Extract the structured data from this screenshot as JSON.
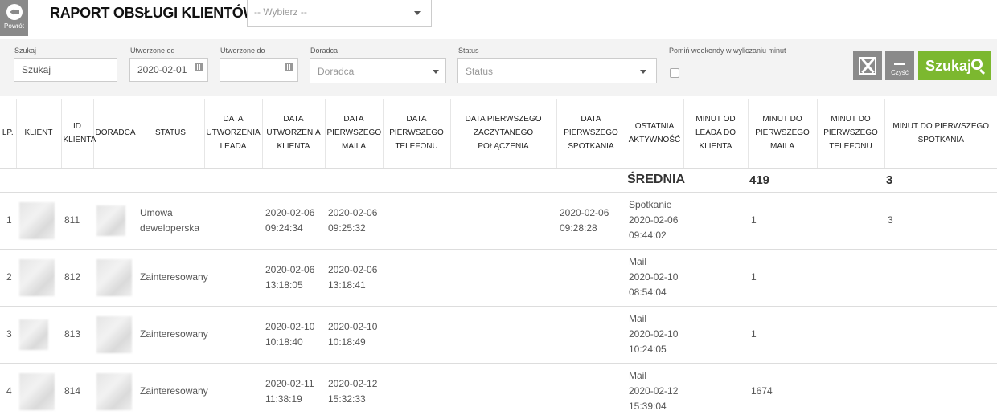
{
  "header": {
    "back_label": "Powrót",
    "title": "RAPORT OBSŁUGI KLIENTÓW",
    "report_select_placeholder": "-- Wybierz --"
  },
  "filters": {
    "search": {
      "label": "Szukaj",
      "value": "Szukaj"
    },
    "created_from": {
      "label": "Utworzone od",
      "value": "2020-02-01"
    },
    "created_to": {
      "label": "Utworzone do",
      "value": ""
    },
    "advisor": {
      "label": "Doradca",
      "placeholder": "Doradca"
    },
    "status": {
      "label": "Status",
      "placeholder": "Status"
    },
    "skip_weekends": {
      "label": "Pomiń weekendy w wyliczaniu minut",
      "checked": false
    },
    "clear_label": "Czyść",
    "search_button_label": "Szukaj"
  },
  "table": {
    "columns": [
      "LP.",
      "KLIENT",
      "ID KLIENTA",
      "DORADCA",
      "STATUS",
      "DATA UTWORZENIA LEADA",
      "DATA UTWORZENIA KLIENTA",
      "DATA PIERWSZEGO MAILA",
      "DATA PIERWSZEGO TELEFONU",
      "DATA PIERWSZEGO ZACZYTANEGO POŁĄCZENIA",
      "DATA PIERWSZEGO SPOTKANIA",
      "OSTATNIA AKTYWNOŚĆ",
      "MINUT OD LEADA DO KLIENTA",
      "MINUT DO PIERWSZEGO MAILA",
      "MINUT DO PIERWSZEGO TELEFONU",
      "MINUT DO PIERWSZEGO SPOTKANIA"
    ],
    "average": {
      "label": "ŚREDNIA",
      "min_to_first_mail": "419",
      "min_to_first_phone": "",
      "min_to_first_meeting": "3"
    },
    "rows": [
      {
        "lp": "1",
        "client_id": "811",
        "status": "Umowa deweloperska",
        "lead_created": "",
        "client_created": "2020-02-06 09:24:34",
        "first_mail": "2020-02-06 09:25:32",
        "first_phone": "",
        "first_call": "",
        "first_meeting": "2020-02-06 09:28:28",
        "last_activity_type": "Spotkanie",
        "last_activity_date": "2020-02-06",
        "last_activity_time": "09:44:02",
        "min_lead_to_client": "",
        "min_to_mail": "1",
        "min_to_phone": "",
        "min_to_meeting": "3"
      },
      {
        "lp": "2",
        "client_id": "812",
        "status": "Zainteresowany",
        "lead_created": "",
        "client_created": "2020-02-06 13:18:05",
        "first_mail": "2020-02-06 13:18:41",
        "first_phone": "",
        "first_call": "",
        "first_meeting": "",
        "last_activity_type": "Mail",
        "last_activity_date": "2020-02-10",
        "last_activity_time": "08:54:04",
        "min_lead_to_client": "",
        "min_to_mail": "1",
        "min_to_phone": "",
        "min_to_meeting": ""
      },
      {
        "lp": "3",
        "client_id": "813",
        "status": "Zainteresowany",
        "lead_created": "",
        "client_created": "2020-02-10 10:18:40",
        "first_mail": "2020-02-10 10:18:49",
        "first_phone": "",
        "first_call": "",
        "first_meeting": "",
        "last_activity_type": "Mail",
        "last_activity_date": "2020-02-10",
        "last_activity_time": "10:24:05",
        "min_lead_to_client": "",
        "min_to_mail": "1",
        "min_to_phone": "",
        "min_to_meeting": ""
      },
      {
        "lp": "4",
        "client_id": "814",
        "status": "Zainteresowany",
        "lead_created": "",
        "client_created": "2020-02-11 11:38:19",
        "first_mail": "2020-02-12 15:32:33",
        "first_phone": "",
        "first_call": "",
        "first_meeting": "",
        "last_activity_type": "Mail",
        "last_activity_date": "2020-02-12",
        "last_activity_time": "15:39:04",
        "min_lead_to_client": "",
        "min_to_mail": "1674",
        "min_to_phone": "",
        "min_to_meeting": ""
      }
    ]
  },
  "colors": {
    "accent_green": "#7cb82f",
    "button_gray": "#8a8a8a",
    "filter_bg": "#f3f3f3"
  },
  "icons": [
    "arrow-left-circle-icon",
    "chevron-down-icon",
    "calendar-icon",
    "excel-icon",
    "minus-icon",
    "search-icon"
  ]
}
